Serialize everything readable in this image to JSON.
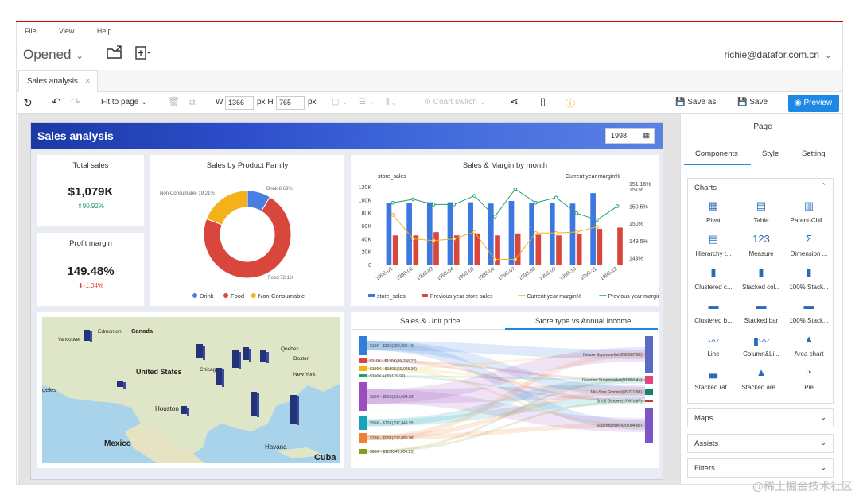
{
  "menu": [
    "File",
    "View",
    "Help"
  ],
  "opened": "Opened",
  "user": "richie@datafor.com.cn",
  "tab": "Sales analysis",
  "toolbar": {
    "fit": "Fit to page",
    "w_label": "W",
    "w_val": "1366",
    "h_label": "px H",
    "h_val": "765",
    "px": "px",
    "coarse": "Coart switch",
    "save_as": "Save as",
    "save": "Save",
    "preview": "Preview"
  },
  "dashboard": {
    "title": "Sales analysis",
    "year": "1998"
  },
  "kpi": {
    "total_title": "Total sales",
    "total_value": "$1,079K",
    "total_delta": "90.92%",
    "margin_title": "Profit margin",
    "margin_value": "149.48%",
    "margin_delta": "-1.04%"
  },
  "donut": {
    "title": "Sales by Product Family",
    "labels": {
      "drink": "Drink 8.63%",
      "food": "Food 72.1%",
      "non": "Non-Consumable 19.21%"
    },
    "chart_data": {
      "type": "pie",
      "categories": [
        "Drink",
        "Food",
        "Non-Consumable"
      ],
      "values": [
        8.63,
        72.1,
        19.21
      ],
      "colors": [
        "#4a7ee0",
        "#d9463b",
        "#f3b21a"
      ]
    }
  },
  "combo": {
    "title": "Sales & Margin by month",
    "left_label": "store_sales",
    "right_label": "Current year margin%",
    "chart_data": {
      "type": "bar",
      "categories": [
        "1998-01",
        "1998-02",
        "1998-03",
        "1998-04",
        "1998-05",
        "1998-06",
        "1998-07",
        "1998-08",
        "1998-09",
        "1998-10",
        "1998-11",
        "1998-12"
      ],
      "ylim": [
        0,
        120000
      ],
      "y2lim": [
        148.8,
        151.3
      ],
      "yticks": [
        "120K",
        "100K",
        "80K",
        "60K",
        "40K",
        "20K",
        "0"
      ],
      "y2ticks": [
        "151.16%",
        "151%",
        "150.5%",
        "150%",
        "149.5%",
        "149%"
      ],
      "series": [
        {
          "name": "store_sales",
          "color": "#3d78e0",
          "values": [
            95000,
            95000,
            96000,
            96000,
            96000,
            94000,
            98000,
            95000,
            95000,
            94000,
            110000,
            null
          ]
        },
        {
          "name": "Previous year store sales",
          "color": "#d9463b",
          "values": [
            45000,
            45000,
            50000,
            45000,
            48000,
            45000,
            48000,
            46000,
            45000,
            47000,
            55000,
            57000
          ]
        },
        {
          "name": "Current year margin%",
          "color": "#f3b21a",
          "values": [
            150.25,
            149.55,
            149.5,
            149.55,
            149.75,
            148.95,
            148.95,
            149.72,
            149.72,
            149.75,
            149.9,
            null
          ]
        },
        {
          "name": "Previous year margin%",
          "color": "#22a06b",
          "values": [
            150.6,
            150.7,
            150.55,
            150.55,
            150.8,
            150.2,
            151.0,
            150.6,
            150.75,
            150.3,
            150.1,
            150.5
          ]
        }
      ]
    }
  },
  "map": {
    "labels": [
      "Edmonton",
      "Canada",
      "Vancouver",
      "United States",
      "Chicago",
      "Quebec",
      "Boston",
      "New York",
      "Houston",
      "Mexico",
      "Havana",
      "Cuba",
      "geles"
    ]
  },
  "sankey": {
    "tab1": "Sales & Unit price",
    "tab2": "Store type vs Annual income",
    "left": [
      "$10K - $30K(252,296.46)",
      "$110K - $130K(39,758.22)",
      "$130K - $150K(60,045.30)",
      "$150K +(20,179.92)",
      "$30K - $50K(255,094.89)",
      "$50K - $70K(197,849.55)",
      "$70K - $90K(132,889.08)",
      "$90K - $110K(46,804.25)"
    ],
    "right": [
      "Deluxe Supermarket(250,607.95)",
      "Gourmet Supermarket(97,891.41)",
      "Mid-Size Grocery(65,771.98)",
      "Small Grocery(17,971.87)",
      "Supermarket(420,004.50)"
    ]
  },
  "sidebar": {
    "page": "Page",
    "tabs": [
      "Components",
      "Style",
      "Setting"
    ],
    "charts": "Charts",
    "items": [
      "Pivot",
      "Table",
      "Parent-Chil...",
      "Hierarchy t...",
      "Measure",
      "Dimension ...",
      "Clustered c...",
      "Stacked col...",
      "100% Stack...",
      "Clustered b...",
      "Stacked bar",
      "100% Stack...",
      "Line",
      "Column&Li...",
      "Area chart",
      "Stacked rat...",
      "Stacked are...",
      "Pie"
    ],
    "maps": "Maps",
    "assists": "Assists",
    "filters": "Filters"
  },
  "watermark": "@稀土掘金技术社区"
}
